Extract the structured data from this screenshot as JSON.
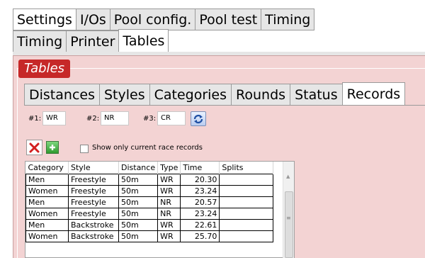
{
  "top_tabs_row1": [
    "Settings",
    "I/Os",
    "Pool config.",
    "Pool test",
    "Timing"
  ],
  "top_tabs_row2": [
    "Timing",
    "Printer",
    "Tables"
  ],
  "group_title": "Tables",
  "inner_tabs": [
    "Distances",
    "Styles",
    "Categories",
    "Rounds",
    "Status",
    "Records"
  ],
  "records_fields": {
    "f1_label": "#1:",
    "f1_value": "WR",
    "f2_label": "#2:",
    "f2_value": "NR",
    "f3_label": "#3:",
    "f3_value": "CR"
  },
  "checkbox_label": "Show only current race records",
  "grid": {
    "headers": [
      "Category",
      "Style",
      "Distance",
      "Type",
      "Time",
      "Splits"
    ],
    "rows": [
      [
        "Men",
        "Freestyle",
        "50m",
        "WR",
        "20.30",
        ""
      ],
      [
        "Women",
        "Freestyle",
        "50m",
        "WR",
        "23.24",
        ""
      ],
      [
        "Men",
        "Freestyle",
        "50m",
        "NR",
        "20.57",
        ""
      ],
      [
        "Women",
        "Freestyle",
        "50m",
        "NR",
        "23.24",
        ""
      ],
      [
        "Men",
        "Backstroke",
        "50m",
        "WR",
        "22.61",
        ""
      ],
      [
        "Women",
        "Backstroke",
        "50m",
        "WR",
        "25.70",
        ""
      ]
    ]
  },
  "colors": {
    "panel_bg": "#f3d3d3",
    "group_title_bg": "#c62828"
  }
}
